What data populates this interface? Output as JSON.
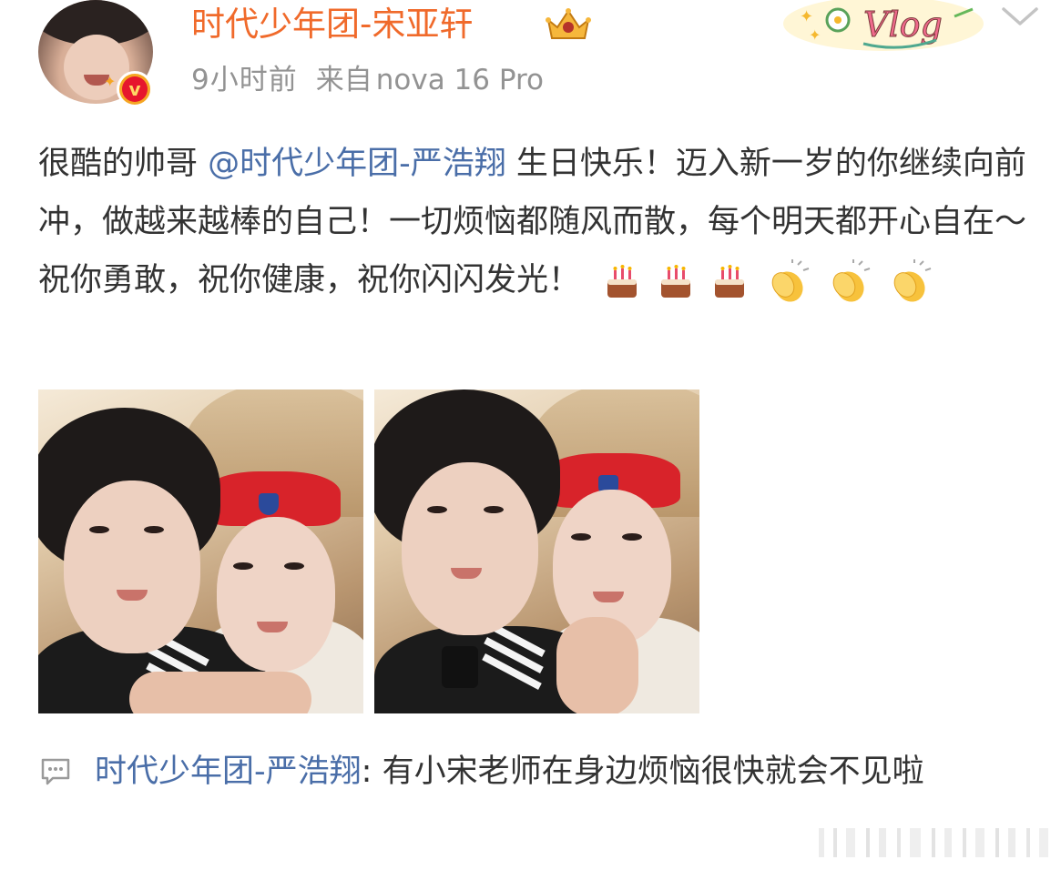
{
  "header": {
    "username": "时代少年团-宋亚轩",
    "timestamp": "9小时前",
    "source_prefix": "来自",
    "device": "nova 16 Pro",
    "vlog_sticker_text": "Vlog",
    "crown_badge_icon": "crown-icon",
    "verified_icon": "verified-v-icon"
  },
  "post": {
    "text_before_mention": "很酷的帅哥",
    "mention": "@时代少年团-严浩翔",
    "text_after_mention": " 生日快乐！迈入新一岁的你继续向前冲，做越来越棒的自己！一切烦恼都随风而散，每个明天都开心自在～祝你勇敢，祝你健康，祝你闪闪发光！",
    "emojis": [
      "cake-emoji",
      "cake-emoji",
      "cake-emoji",
      "clap-emoji",
      "clap-emoji",
      "clap-emoji"
    ]
  },
  "photos": [
    {
      "name": "photo-1"
    },
    {
      "name": "photo-2"
    }
  ],
  "comment": {
    "author": "时代少年团-严浩翔",
    "separator": ": ",
    "text": "有小宋老师在身边烦恼很快就会不见啦",
    "icon": "comment-icon"
  },
  "colors": {
    "username": "#f06a2b",
    "mention": "#4a6ea8",
    "meta": "#939393",
    "text": "#333333"
  }
}
